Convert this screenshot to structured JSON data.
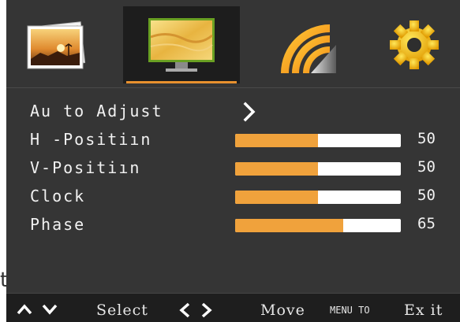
{
  "tabs": [
    {
      "icon": "picture-icon",
      "active": false
    },
    {
      "icon": "screen-icon",
      "active": true
    },
    {
      "icon": "signal-icon",
      "active": false
    },
    {
      "icon": "settings-gear-icon",
      "active": false
    }
  ],
  "menu": {
    "items": [
      {
        "label": "Au to Adjust",
        "type": "submenu"
      },
      {
        "label": "H -Positiın",
        "type": "slider",
        "value": "50"
      },
      {
        "label": "V-Positiın",
        "type": "slider",
        "value": "50"
      },
      {
        "label": "Clock",
        "type": "slider",
        "value": "50"
      },
      {
        "label": "Phase",
        "type": "slider",
        "value": "65"
      }
    ]
  },
  "footer": {
    "select_label": "Select",
    "move_label": "Move",
    "menu_to_label": "MENU TO",
    "exit_label": "Ex it"
  },
  "stray_text": "t",
  "colors": {
    "background": "#353535",
    "accent": "#f0a23c",
    "track": "#ffffff",
    "footer": "#1e1e1e"
  }
}
